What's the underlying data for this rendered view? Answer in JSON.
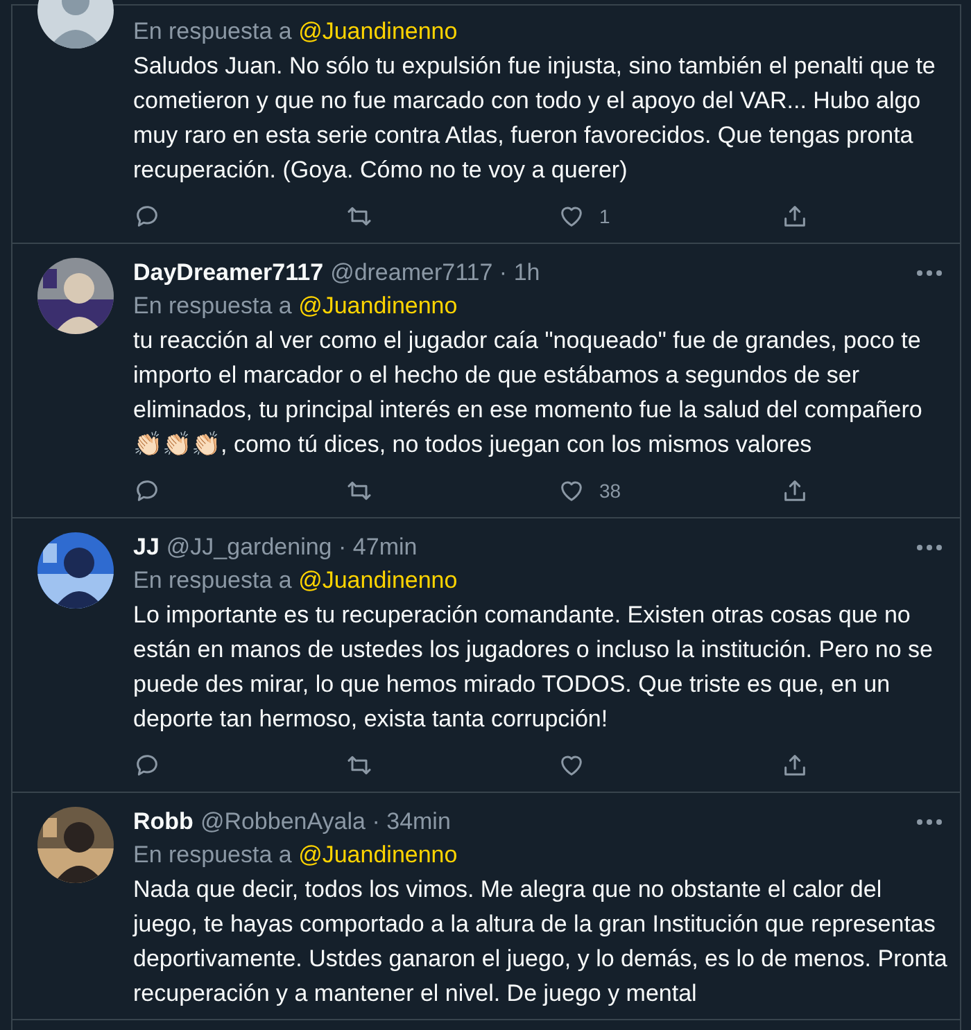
{
  "tweets": [
    {
      "avatar": {
        "kind": "icon"
      },
      "reply_label": "En respuesta a",
      "reply_to": "@Juandinenno",
      "text": "Saludos Juan. No sólo tu expulsión fue injusta, sino también el penalti que te cometieron y que no fue marcado con todo y el apoyo del VAR... Hubo algo muy raro en esta serie contra Atlas, fueron favorecidos. Que tengas pronta recuperación. (Goya. Cómo no te voy a querer)",
      "actions": [
        {
          "kind": "reply"
        },
        {
          "kind": "retweet"
        },
        {
          "kind": "like",
          "count": "1"
        },
        {
          "kind": "share"
        }
      ]
    },
    {
      "name": "DayDreamer7117",
      "handle": "@dreamer7117",
      "separator": "·",
      "time": "1h",
      "reply_label": "En respuesta a",
      "reply_to": "@Juandinenno",
      "text": "tu reacción al ver como el jugador caía \"noqueado\" fue de grandes, poco te importo el marcador o el hecho de que estábamos a segundos de ser eliminados, tu principal interés en ese momento fue la salud del compañero 👏🏻👏🏻👏🏻, como tú dices, no todos juegan con los mismos valores",
      "actions": [
        {
          "kind": "reply"
        },
        {
          "kind": "retweet"
        },
        {
          "kind": "like",
          "count": "38"
        },
        {
          "kind": "share"
        }
      ]
    },
    {
      "name": "JJ",
      "handle": "@JJ_gardening",
      "separator": "·",
      "time": "47min",
      "reply_label": "En respuesta a",
      "reply_to": "@Juandinenno",
      "text": "Lo importante es tu recuperación comandante. Existen otras cosas que no están en manos de ustedes los jugadores o incluso la institución. Pero no se puede des mirar, lo que hemos mirado TODOS. Que triste es que, en un deporte tan hermoso, exista tanta corrupción!",
      "actions": [
        {
          "kind": "reply"
        },
        {
          "kind": "retweet"
        },
        {
          "kind": "like"
        },
        {
          "kind": "share"
        }
      ]
    },
    {
      "name": "Robb",
      "handle": "@RobbenAyala",
      "separator": "·",
      "time": "34min",
      "reply_label": "En respuesta a",
      "reply_to": "@Juandinenno",
      "text": "Nada que decir, todos los vimos. Me alegra que no obstante el calor del juego, te hayas comportado a la altura de la gran Institución que representas deportivamente. Ustdes ganaron el juego, y lo demás, es lo de menos. Pronta recuperación y a mantener el nivel. De juego y mental"
    }
  ]
}
